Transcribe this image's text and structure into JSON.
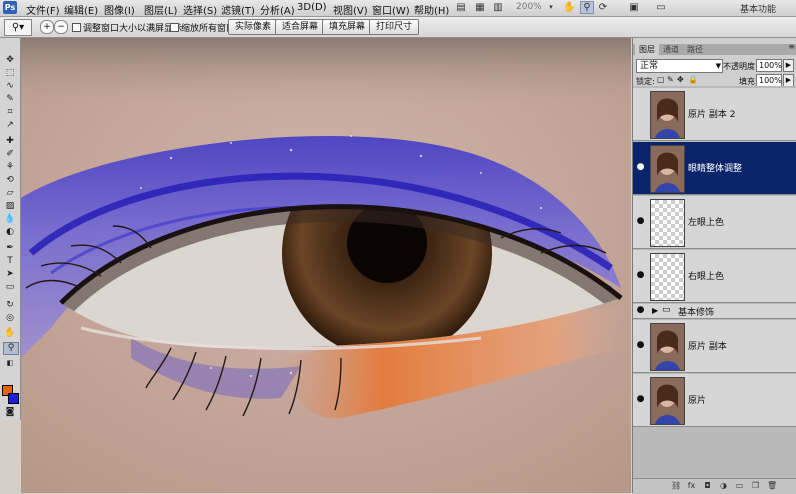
{
  "menubar": {
    "logo": "Ps",
    "items": [
      "文件(F)",
      "编辑(E)",
      "图像(I)",
      "图层(L)",
      "选择(S)",
      "滤镜(T)",
      "分析(A)",
      "3D(D)",
      "视图(V)",
      "窗口(W)",
      "帮助(H)"
    ],
    "zoom_display": "200%",
    "workspace": "基本功能"
  },
  "options": {
    "checkbox_resize": "调整窗口大小以满屏显示",
    "checkbox_zoom_all": "缩放所有窗口",
    "btn_actual": "实际像素",
    "btn_fit": "适合屏幕",
    "btn_fill": "填充屏幕",
    "btn_print": "打印尺寸"
  },
  "layers_panel": {
    "tabs": [
      "图层",
      "通道",
      "路径"
    ],
    "blend_mode": "正常",
    "opacity_label": "不透明度:",
    "opacity_value": "100%",
    "lock_label": "锁定:",
    "fill_label": "填充:",
    "fill_value": "100%",
    "layers": [
      {
        "name": "原片 副本 2",
        "visible": false,
        "selected": false,
        "type": "photo"
      },
      {
        "name": "眼睛整体调整",
        "visible": true,
        "selected": true,
        "type": "photo"
      },
      {
        "name": "左眼上色",
        "visible": true,
        "selected": false,
        "type": "transparent"
      },
      {
        "name": "右眼上色",
        "visible": true,
        "selected": false,
        "type": "transparent"
      },
      {
        "name": "基本修饰",
        "visible": true,
        "selected": false,
        "type": "group"
      },
      {
        "name": "原片 副本",
        "visible": true,
        "selected": false,
        "type": "photo"
      },
      {
        "name": "原片",
        "visible": true,
        "selected": false,
        "type": "photo"
      }
    ]
  },
  "colors": {
    "foreground": "#e2620a",
    "background": "#1f1fdb",
    "selection": "#0a246a"
  }
}
